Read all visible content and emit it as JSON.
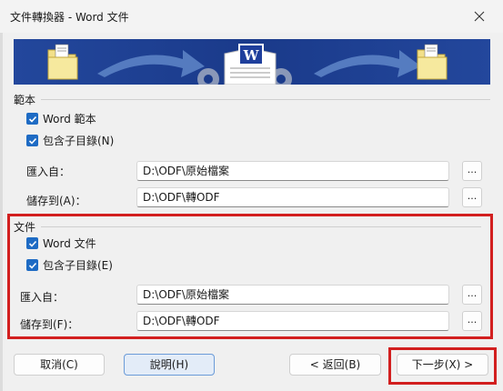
{
  "window": {
    "title": "文件轉換器 - Word 文件"
  },
  "template_group": {
    "title": "範本",
    "check_word": "Word 範本",
    "check_subdirs": "包含子目錄(N)",
    "import_label": "匯入自：",
    "import_value": "D:\\ODF\\原始檔案",
    "save_label": "儲存到(A)：",
    "save_value": "D:\\ODF\\轉ODF",
    "browse_label": "..."
  },
  "document_group": {
    "title": "文件",
    "check_word": "Word 文件",
    "check_subdirs": "包含子目錄(E)",
    "import_label": "匯入自：",
    "import_value": "D:\\ODF\\原始檔案",
    "save_label": "儲存到(F)：",
    "save_value": "D:\\ODF\\轉ODF",
    "browse_label": "..."
  },
  "buttons": {
    "cancel": "取消(C)",
    "help": "說明(H)",
    "back": "< 返回(B)",
    "next": "下一步(X) >"
  },
  "colors": {
    "accent": "#1e6bc4",
    "highlight": "#d21f1f",
    "banner": "#1b3d8f"
  },
  "icons": [
    "close-icon",
    "checkmark-icon",
    "folder-icon",
    "arrow-right-icon",
    "gear-icon",
    "word-document-icon"
  ]
}
